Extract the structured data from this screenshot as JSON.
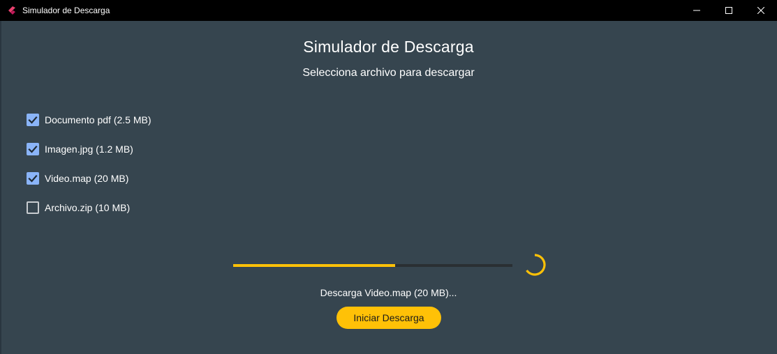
{
  "window": {
    "title": "Simulador de Descarga",
    "icon": "flutter-icon",
    "controls": [
      "minimize-icon",
      "maximize-icon",
      "close-icon"
    ]
  },
  "main": {
    "title": "Simulador de Descarga",
    "subtitle": "Selecciona archivo para descargar",
    "files": [
      {
        "label": "Documento pdf (2.5 MB)",
        "checked": true
      },
      {
        "label": "Imagen.jpg (1.2 MB)",
        "checked": true
      },
      {
        "label": "Video.map (20 MB)",
        "checked": true
      },
      {
        "label": "Archivo.zip (10 MB)",
        "checked": false
      }
    ],
    "progress": 0.58,
    "status": "Descarga Video.map (20 MB)...",
    "start_button": "Iniciar Descarga"
  },
  "colors": {
    "background": "#36454f",
    "titlebar": "#000000",
    "accent": "#ffc107",
    "checkbox": "#8ab4f8",
    "track": "#2a2f33"
  }
}
